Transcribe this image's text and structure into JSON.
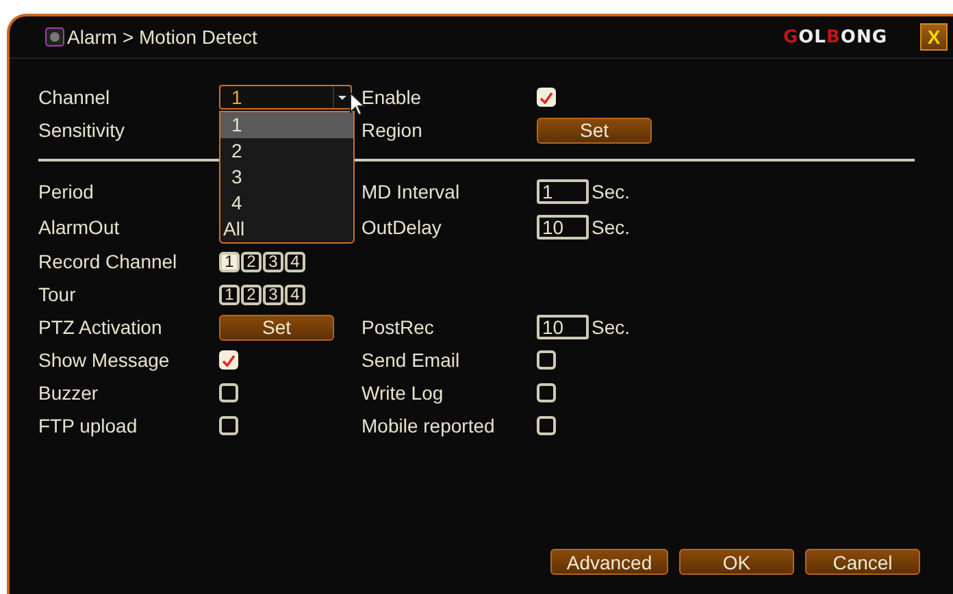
{
  "window": {
    "title": "Alarm > Motion Detect",
    "logo": [
      {
        "text": "G",
        "accent": true
      },
      {
        "text": "OL",
        "accent": false
      },
      {
        "text": "B",
        "accent": true
      },
      {
        "text": "ONG",
        "accent": false
      }
    ],
    "close": "X"
  },
  "rows": [
    {
      "label": "Channel",
      "control": {
        "kind": "dropdown",
        "value": "1",
        "options": [
          {
            "label": "1",
            "selected": true
          },
          {
            "label": "2",
            "selected": false
          },
          {
            "label": "3",
            "selected": false
          },
          {
            "label": "4",
            "selected": false
          },
          {
            "label": "All",
            "selected": false
          }
        ]
      },
      "right": {
        "label": "Enable",
        "control": {
          "kind": "checkbox",
          "checked": true
        }
      }
    },
    {
      "label": "Sensitivity",
      "right": {
        "label": "Region",
        "control": {
          "kind": "button",
          "label": "Set"
        }
      }
    },
    {
      "kind": "divider"
    },
    {
      "label": "Period",
      "right": {
        "label": "MD Interval",
        "control": {
          "kind": "field",
          "value": "1",
          "unit": "Sec."
        }
      }
    },
    {
      "label": "AlarmOut",
      "right": {
        "label": "OutDelay",
        "control": {
          "kind": "field",
          "value": "10",
          "unit": "Sec."
        }
      }
    },
    {
      "label": "Record Channel",
      "control": {
        "kind": "toggles",
        "items": [
          {
            "label": "1",
            "selected": true
          },
          {
            "label": "2",
            "selected": false
          },
          {
            "label": "3",
            "selected": false
          },
          {
            "label": "4",
            "selected": false
          }
        ]
      }
    },
    {
      "label": "Tour",
      "control": {
        "kind": "toggles",
        "items": [
          {
            "label": "1",
            "selected": false
          },
          {
            "label": "2",
            "selected": false
          },
          {
            "label": "3",
            "selected": false
          },
          {
            "label": "4",
            "selected": false
          }
        ]
      }
    },
    {
      "label": "PTZ Activation",
      "control": {
        "kind": "button",
        "label": "Set"
      },
      "right": {
        "label": "PostRec",
        "control": {
          "kind": "field",
          "value": "10",
          "unit": "Sec."
        }
      }
    },
    {
      "label": "Show Message",
      "control": {
        "kind": "checkbox",
        "checked": true
      },
      "right": {
        "label": "Send Email",
        "control": {
          "kind": "checkbox",
          "checked": false
        }
      }
    },
    {
      "label": "Buzzer",
      "control": {
        "kind": "checkbox",
        "checked": false
      },
      "right": {
        "label": "Write Log",
        "control": {
          "kind": "checkbox",
          "checked": false
        }
      }
    },
    {
      "label": "FTP upload",
      "control": {
        "kind": "checkbox",
        "checked": false
      },
      "right": {
        "label": "Mobile reported",
        "control": {
          "kind": "checkbox",
          "checked": false
        }
      }
    }
  ],
  "buttons": [
    "Advanced",
    "OK",
    "Cancel"
  ]
}
